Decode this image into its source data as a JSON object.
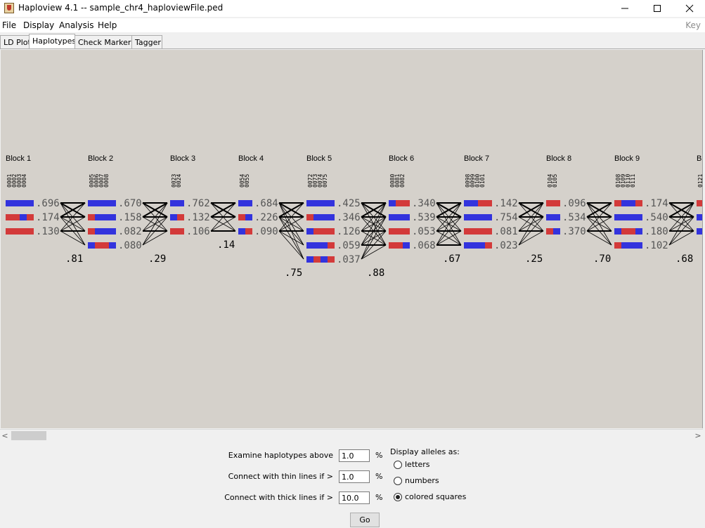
{
  "window": {
    "title": "Haploview 4.1 -- sample_chr4_haploviewFile.ped"
  },
  "menu": {
    "items": [
      "File",
      "Display",
      "Analysis",
      "Help"
    ],
    "key": "Key"
  },
  "tabs": [
    "LD Plot",
    "Haplotypes",
    "Check Markers",
    "Tagger"
  ],
  "active_tab": "Haplotypes",
  "colors": {
    "allele_blue": "#3333dd",
    "allele_red": "#d33a3a",
    "panel_bg": "#d5d1cb"
  },
  "blocks": [
    {
      "name": "Block 1",
      "markers": [
        "0001",
        "0002",
        "0003",
        "0004"
      ],
      "haplotypes": [
        {
          "pattern": "BBBB",
          "freq": ".696"
        },
        {
          "pattern": "RRBR",
          "freq": ".174"
        },
        {
          "pattern": "RRRR",
          "freq": ".130"
        }
      ],
      "multiallelic_d": ".81"
    },
    {
      "name": "Block 2",
      "markers": [
        "0005",
        "0006",
        "0007",
        "0008"
      ],
      "haplotypes": [
        {
          "pattern": "BBBB",
          "freq": ".670"
        },
        {
          "pattern": "RBBB",
          "freq": ".158"
        },
        {
          "pattern": "RBBB",
          "freq": ".082"
        },
        {
          "pattern": "BRRB",
          "freq": ".080"
        }
      ],
      "multiallelic_d": ".29"
    },
    {
      "name": "Block 3",
      "markers": [
        "0023",
        "0024"
      ],
      "haplotypes": [
        {
          "pattern": "BB",
          "freq": ".762"
        },
        {
          "pattern": "BR",
          "freq": ".132"
        },
        {
          "pattern": "RR",
          "freq": ".106"
        }
      ],
      "multiallelic_d": ".14"
    },
    {
      "name": "Block 4",
      "markers": [
        "0054",
        "0055"
      ],
      "haplotypes": [
        {
          "pattern": "BB",
          "freq": ".684"
        },
        {
          "pattern": "RB",
          "freq": ".226"
        },
        {
          "pattern": "BR",
          "freq": ".090"
        }
      ],
      "multiallelic_d": ".75"
    },
    {
      "name": "Block 5",
      "markers": [
        "0072",
        "0073",
        "0074",
        "0075"
      ],
      "haplotypes": [
        {
          "pattern": "BBBB",
          "freq": ".425"
        },
        {
          "pattern": "RBBB",
          "freq": ".346"
        },
        {
          "pattern": "BRRR",
          "freq": ".126"
        },
        {
          "pattern": "BBBR",
          "freq": ".059"
        },
        {
          "pattern": "BRBR",
          "freq": ".037"
        }
      ],
      "multiallelic_d": ".88"
    },
    {
      "name": "Block 6",
      "markers": [
        "0080",
        "0081",
        "0082"
      ],
      "haplotypes": [
        {
          "pattern": "BRR",
          "freq": ".340"
        },
        {
          "pattern": "BBB",
          "freq": ".539"
        },
        {
          "pattern": "RRR",
          "freq": ".053"
        },
        {
          "pattern": "RRB",
          "freq": ".068"
        }
      ],
      "multiallelic_d": ".67"
    },
    {
      "name": "Block 7",
      "markers": [
        "0098",
        "0099",
        "0100",
        "0101"
      ],
      "haplotypes": [
        {
          "pattern": "BBRR",
          "freq": ".142"
        },
        {
          "pattern": "BBBB",
          "freq": ".754"
        },
        {
          "pattern": "RRRR",
          "freq": ".081"
        },
        {
          "pattern": "BBBR",
          "freq": ".023"
        }
      ],
      "multiallelic_d": ".25"
    },
    {
      "name": "Block 8",
      "markers": [
        "0104",
        "0105"
      ],
      "haplotypes": [
        {
          "pattern": "RR",
          "freq": ".096"
        },
        {
          "pattern": "BB",
          "freq": ".534"
        },
        {
          "pattern": "RB",
          "freq": ".370"
        }
      ],
      "multiallelic_d": ".70"
    },
    {
      "name": "Block 9",
      "markers": [
        "0108",
        "0109",
        "0110",
        "0111"
      ],
      "haplotypes": [
        {
          "pattern": "RBBR",
          "freq": ".174"
        },
        {
          "pattern": "BBBB",
          "freq": ".540"
        },
        {
          "pattern": "BRRB",
          "freq": ".180"
        },
        {
          "pattern": "RBBB",
          "freq": ".102"
        }
      ],
      "multiallelic_d": ".68"
    },
    {
      "name": "Bl",
      "markers": [
        "0121"
      ],
      "haplotypes": [
        {
          "pattern": "R",
          "freq": ""
        },
        {
          "pattern": "B",
          "freq": ""
        },
        {
          "pattern": "B",
          "freq": ""
        }
      ],
      "multiallelic_d": ""
    }
  ],
  "controls": {
    "examine_label": "Examine haplotypes above",
    "examine_value": "1.0",
    "thin_label": "Connect with thin lines if >",
    "thin_value": "1.0",
    "thick_label": "Connect with thick lines if >",
    "thick_value": "10.0",
    "percent": "%",
    "display_label": "Display alleles as:",
    "options": [
      "letters",
      "numbers",
      "colored squares"
    ],
    "selected_option": "colored squares",
    "go_label": "Go"
  }
}
